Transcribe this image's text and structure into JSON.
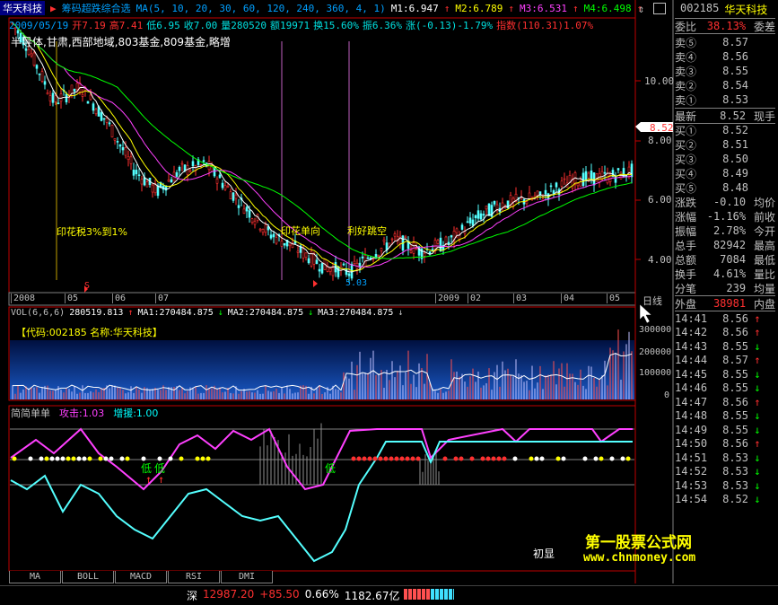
{
  "header": {
    "stock_name": "华天科技",
    "indicator_name": "筹码超跌综合选",
    "ma_params": "MA(5, 10, 20, 30, 60, 120, 240, 360, 4, 1)",
    "m1": "M1:6.947",
    "m2": "M2:6.789",
    "m3": "M3:6.531",
    "m4": "M4:6.498",
    "date": "2009/05/19",
    "open": "开7.19",
    "high": "高7.41",
    "low": "低6.95",
    "close": "收7.00",
    "volume": "量280520",
    "amount": "额19971",
    "change_pct": "换15.60%",
    "amplitude": "振6.36%",
    "change": "涨(-0.13)-1.79%",
    "index": "指数(110.31)1.07%",
    "concepts": "半导体,甘肃,西部地域,803基金,809基金,略增"
  },
  "price_axis": [
    "10.00",
    "8.00",
    "6.00",
    "4.00"
  ],
  "price_marker": "8.52",
  "annotations": {
    "stamp_tax_cut": "印花税3%到1%",
    "stamp_single": "印花单向",
    "good_news": "利好跳空",
    "low_price_marker": "5.03",
    "low_signal_1": "低",
    "low_signal_2": "低",
    "low_signal_3": "低",
    "initial": "初显"
  },
  "date_axis": [
    "2008",
    "05",
    "06",
    "07",
    "2009",
    "02",
    "03",
    "04",
    "05"
  ],
  "date_axis_right": "日线",
  "volume_panel": {
    "label": "VOL(6,6,6)",
    "vol": "280519.813",
    "ma1": "MA1:270484.875",
    "ma2": "MA2:270484.875",
    "ma3": "MA3:270484.875",
    "code_title": "【代码:002185 名称:华天科技】",
    "axis": [
      "300000",
      "200000",
      "100000",
      "0"
    ]
  },
  "indicator_panel": {
    "name": "简简单单",
    "attack": "攻击:1.03",
    "boost": "增援:1.00"
  },
  "tabs": [
    "MA",
    "BOLL",
    "MACD",
    "RSI",
    "DMI"
  ],
  "status_bar": {
    "market": "深",
    "index_value": "12987.20",
    "index_change": "+85.50",
    "index_pct": "0.66%",
    "turnover": "1182.67亿"
  },
  "right_panel": {
    "code": "002185",
    "name": "华天科技",
    "ratio_label": "委比",
    "ratio_value": "38.13%",
    "diff_label": "委差",
    "asks": [
      {
        "label": "卖⑤",
        "price": "8.57",
        "vol": ""
      },
      {
        "label": "卖④",
        "price": "8.56",
        "vol": ""
      },
      {
        "label": "卖③",
        "price": "8.55",
        "vol": ""
      },
      {
        "label": "卖②",
        "price": "8.54",
        "vol": ""
      },
      {
        "label": "卖①",
        "price": "8.53",
        "vol": ""
      }
    ],
    "latest": {
      "label": "最新",
      "price": "8.52",
      "tail": "现手"
    },
    "bids": [
      {
        "label": "买①",
        "price": "8.52"
      },
      {
        "label": "买②",
        "price": "8.51"
      },
      {
        "label": "买③",
        "price": "8.50"
      },
      {
        "label": "买④",
        "price": "8.49"
      },
      {
        "label": "买⑤",
        "price": "8.48"
      }
    ],
    "stats": [
      {
        "k": "涨跌",
        "v": "-0.10",
        "t": "均价"
      },
      {
        "k": "涨幅",
        "v": "-1.16%",
        "t": "前收"
      },
      {
        "k": "振幅",
        "v": "2.78%",
        "t": "今开"
      },
      {
        "k": "总手",
        "v": "82942",
        "t": "最高"
      },
      {
        "k": "总额",
        "v": "7084",
        "t": "最低"
      },
      {
        "k": "换手",
        "v": "4.61%",
        "t": "量比"
      },
      {
        "k": "分笔",
        "v": "239",
        "t": "均量"
      }
    ],
    "outer_label": "外盘",
    "outer_value": "38981",
    "inner_label": "内盘",
    "ticks": [
      {
        "time": "14:41",
        "price": "8.56",
        "dir": "↑"
      },
      {
        "time": "14:42",
        "price": "8.56",
        "dir": "↑"
      },
      {
        "time": "14:43",
        "price": "8.55",
        "dir": "↓"
      },
      {
        "time": "14:44",
        "price": "8.57",
        "dir": "↑"
      },
      {
        "time": "14:45",
        "price": "8.55",
        "dir": "↓"
      },
      {
        "time": "14:46",
        "price": "8.55",
        "dir": "↓"
      },
      {
        "time": "14:47",
        "price": "8.56",
        "dir": "↑"
      },
      {
        "time": "14:48",
        "price": "8.55",
        "dir": "↓"
      },
      {
        "time": "14:49",
        "price": "8.55",
        "dir": "↓"
      },
      {
        "time": "14:50",
        "price": "8.56",
        "dir": "↑"
      },
      {
        "time": "14:51",
        "price": "8.53",
        "dir": "↓"
      },
      {
        "time": "14:52",
        "price": "8.53",
        "dir": "↓"
      },
      {
        "time": "14:53",
        "price": "8.53",
        "dir": "↓"
      },
      {
        "time": "14:54",
        "price": "8.52",
        "dir": "↓"
      }
    ]
  },
  "watermark": {
    "title": "第一股票公式网",
    "url": "www.chnmoney.com"
  },
  "colors": {
    "up": "#ff3030",
    "down": "#54ffff",
    "yellow": "#ffff00",
    "magenta": "#ff40ff",
    "green": "#00ff00",
    "grid": "#a00000",
    "frame": "#c00000"
  }
}
